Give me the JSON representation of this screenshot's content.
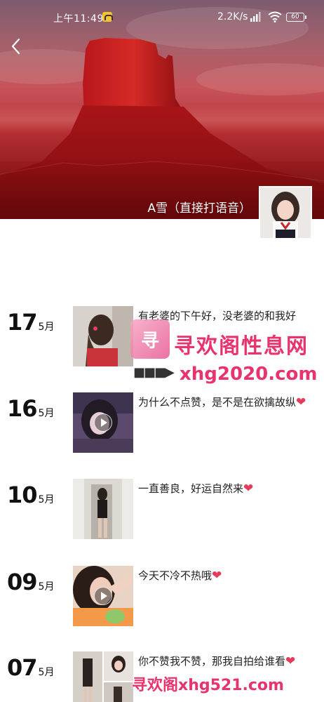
{
  "status_bar": {
    "time": "上午11:49",
    "network_speed": "2.2K/s",
    "battery": "60"
  },
  "profile": {
    "name": "A雪（直接打语音）"
  },
  "posts": [
    {
      "day": "17",
      "month": "5月",
      "text": "有老婆的下午好，没老婆的和我好",
      "heart": false,
      "media": "photo"
    },
    {
      "day": "16",
      "month": "5月",
      "text": "为什么不点赞，是不是在欲擒故纵",
      "heart": true,
      "media": "video"
    },
    {
      "day": "10",
      "month": "5月",
      "text": "一直善良，好运自然来",
      "heart": true,
      "media": "photo"
    },
    {
      "day": "09",
      "month": "5月",
      "text": "今天不冷不热哦",
      "heart": true,
      "media": "video"
    },
    {
      "day": "07",
      "month": "5月",
      "text": "你不赞我不赞，那我自拍给谁看",
      "heart": true,
      "media": "photo-grid"
    }
  ],
  "watermark": {
    "logo_text": "寻",
    "title": "寻欢阁性息网",
    "arrow": "■■■▶",
    "url": "xhg2020.com",
    "bottom": "寻欢阁xhg521.com"
  },
  "heart_glyph": "❤",
  "colors": {
    "accent_pink": "#e8336d",
    "heart": "#e53a5a",
    "cover_red": "#b52f33"
  }
}
